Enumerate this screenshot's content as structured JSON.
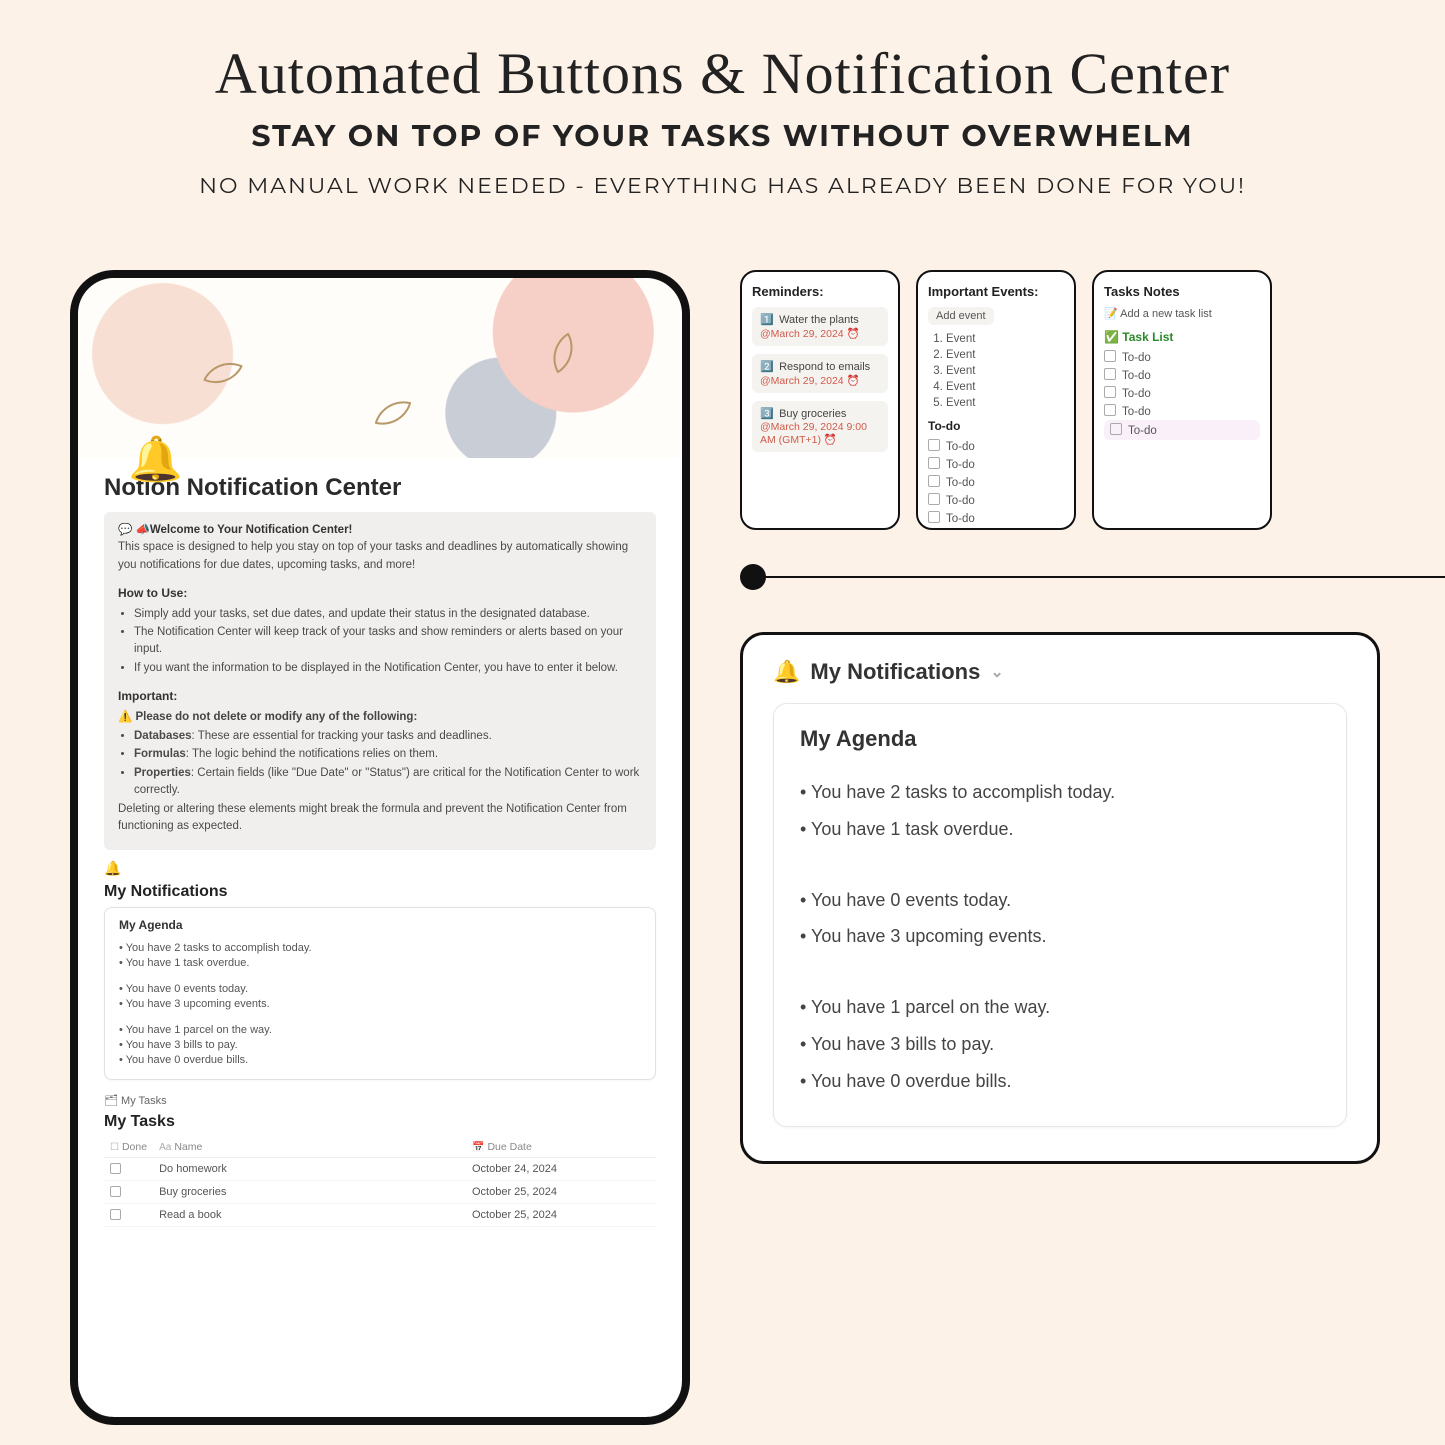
{
  "hero": {
    "script_title": "Automated Buttons & Notification Center",
    "headline": "STAY ON TOP OF YOUR TASKS WITHOUT OVERWHELM",
    "subhead": "NO MANUAL WORK NEEDED - EVERYTHING HAS ALREADY BEEN DONE FOR YOU!"
  },
  "tablet": {
    "page_title": "Notion Notification Center",
    "welcome_line": "📣Welcome to Your Notification Center!",
    "welcome_body": "This space is designed to help you stay on top of your tasks and deadlines by automatically showing you notifications for due dates, upcoming tasks, and more!",
    "howto_heading": "How to Use:",
    "howto_items": [
      "Simply add your tasks, set due dates, and update their status in the designated database.",
      "The Notification Center will keep track of your tasks and show reminders or alerts based on your input.",
      "If you want the information to be displayed in the Notification Center, you have to enter it below."
    ],
    "important_heading": "Important:",
    "warn_line": "Please do not delete or modify any of the following:",
    "important_items": [
      "Databases: These are essential for tracking your tasks and deadlines.",
      "Formulas: The logic behind the notifications relies on them.",
      "Properties: Certain fields (like \"Due Date\" or \"Status\") are critical for the Notification Center to work correctly."
    ],
    "important_footer": "Deleting or altering these elements might break the formula and prevent the Notification Center from functioning as expected.",
    "notifications_heading": "My Notifications",
    "agenda_heading": "My Agenda",
    "agenda_lines_a": [
      "You have 2 tasks to accomplish today.",
      "You have 1 task overdue."
    ],
    "agenda_lines_b": [
      "You have 0 events today.",
      "You have 3 upcoming events."
    ],
    "agenda_lines_c": [
      "You have 1 parcel on the way.",
      "You have 3 bills to pay.",
      "You have 0 overdue bills."
    ],
    "tasks_db_label": "My Tasks",
    "tasks_heading": "My Tasks",
    "tasks_cols": {
      "done": "Done",
      "name": "Name",
      "due": "Due Date"
    },
    "tasks_rows": [
      {
        "name": "Do homework",
        "due": "October 24, 2024"
      },
      {
        "name": "Buy groceries",
        "due": "October 25, 2024"
      },
      {
        "name": "Read a book",
        "due": "October 25, 2024"
      }
    ]
  },
  "widgets": {
    "reminders": {
      "title": "Reminders:",
      "items": [
        {
          "num": "1️⃣",
          "title": "Water the plants",
          "date": "March 29, 2024"
        },
        {
          "num": "2️⃣",
          "title": "Respond to emails",
          "date": "March 29, 2024"
        },
        {
          "num": "3️⃣",
          "title": "Buy groceries",
          "date": "March 29, 2024 9:00 AM (GMT+1)"
        }
      ]
    },
    "events": {
      "title": "Important Events:",
      "add_btn": "Add event",
      "items": [
        "Event",
        "Event",
        "Event",
        "Event",
        "Event"
      ],
      "todo_title": "To-do",
      "todos": [
        "To-do",
        "To-do",
        "To-do",
        "To-do",
        "To-do"
      ]
    },
    "notes": {
      "title": "Tasks Notes",
      "add_link": "Add a new task list",
      "tasklist_head": "Task List",
      "todos": [
        "To-do",
        "To-do",
        "To-do",
        "To-do",
        "To-do"
      ]
    }
  },
  "notif_card": {
    "header": "My Notifications",
    "agenda_heading": "My Agenda",
    "group_a": [
      "You have 2 tasks to accomplish today.",
      "You have 1 task overdue."
    ],
    "group_b": [
      "You have 0 events today.",
      "You have 3 upcoming events."
    ],
    "group_c": [
      "You have 1 parcel on the way.",
      "You have 3 bills to pay.",
      "You have 0 overdue bills."
    ]
  }
}
